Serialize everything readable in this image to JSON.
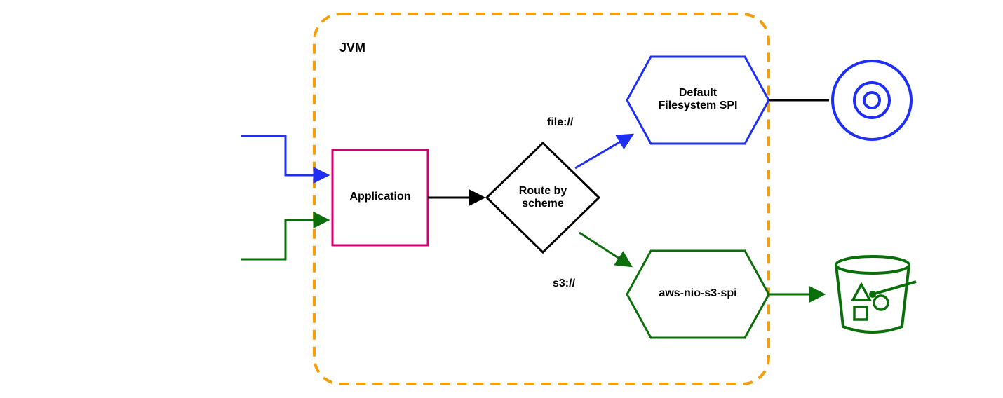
{
  "container": {
    "label": "JVM"
  },
  "nodes": {
    "application": {
      "label": "Application"
    },
    "router": {
      "line1": "Route by",
      "line2": "scheme"
    },
    "defaultFs": {
      "line1": "Default",
      "line2": "Filesystem SPI"
    },
    "s3Spi": {
      "label": "aws-nio-s3-spi"
    }
  },
  "edges": {
    "fileScheme": {
      "label": "file://"
    },
    "s3Scheme": {
      "label": "s3://"
    }
  },
  "colors": {
    "containerBorder": "#f59e0b",
    "applicationBorder": "#d1006f",
    "routerBorder": "#000000",
    "defaultFsBorder": "#1e2ef5",
    "s3SpiBorder": "#0a6e0a",
    "black": "#000000",
    "blue": "#1e2ef5",
    "green": "#0a6e0a"
  }
}
